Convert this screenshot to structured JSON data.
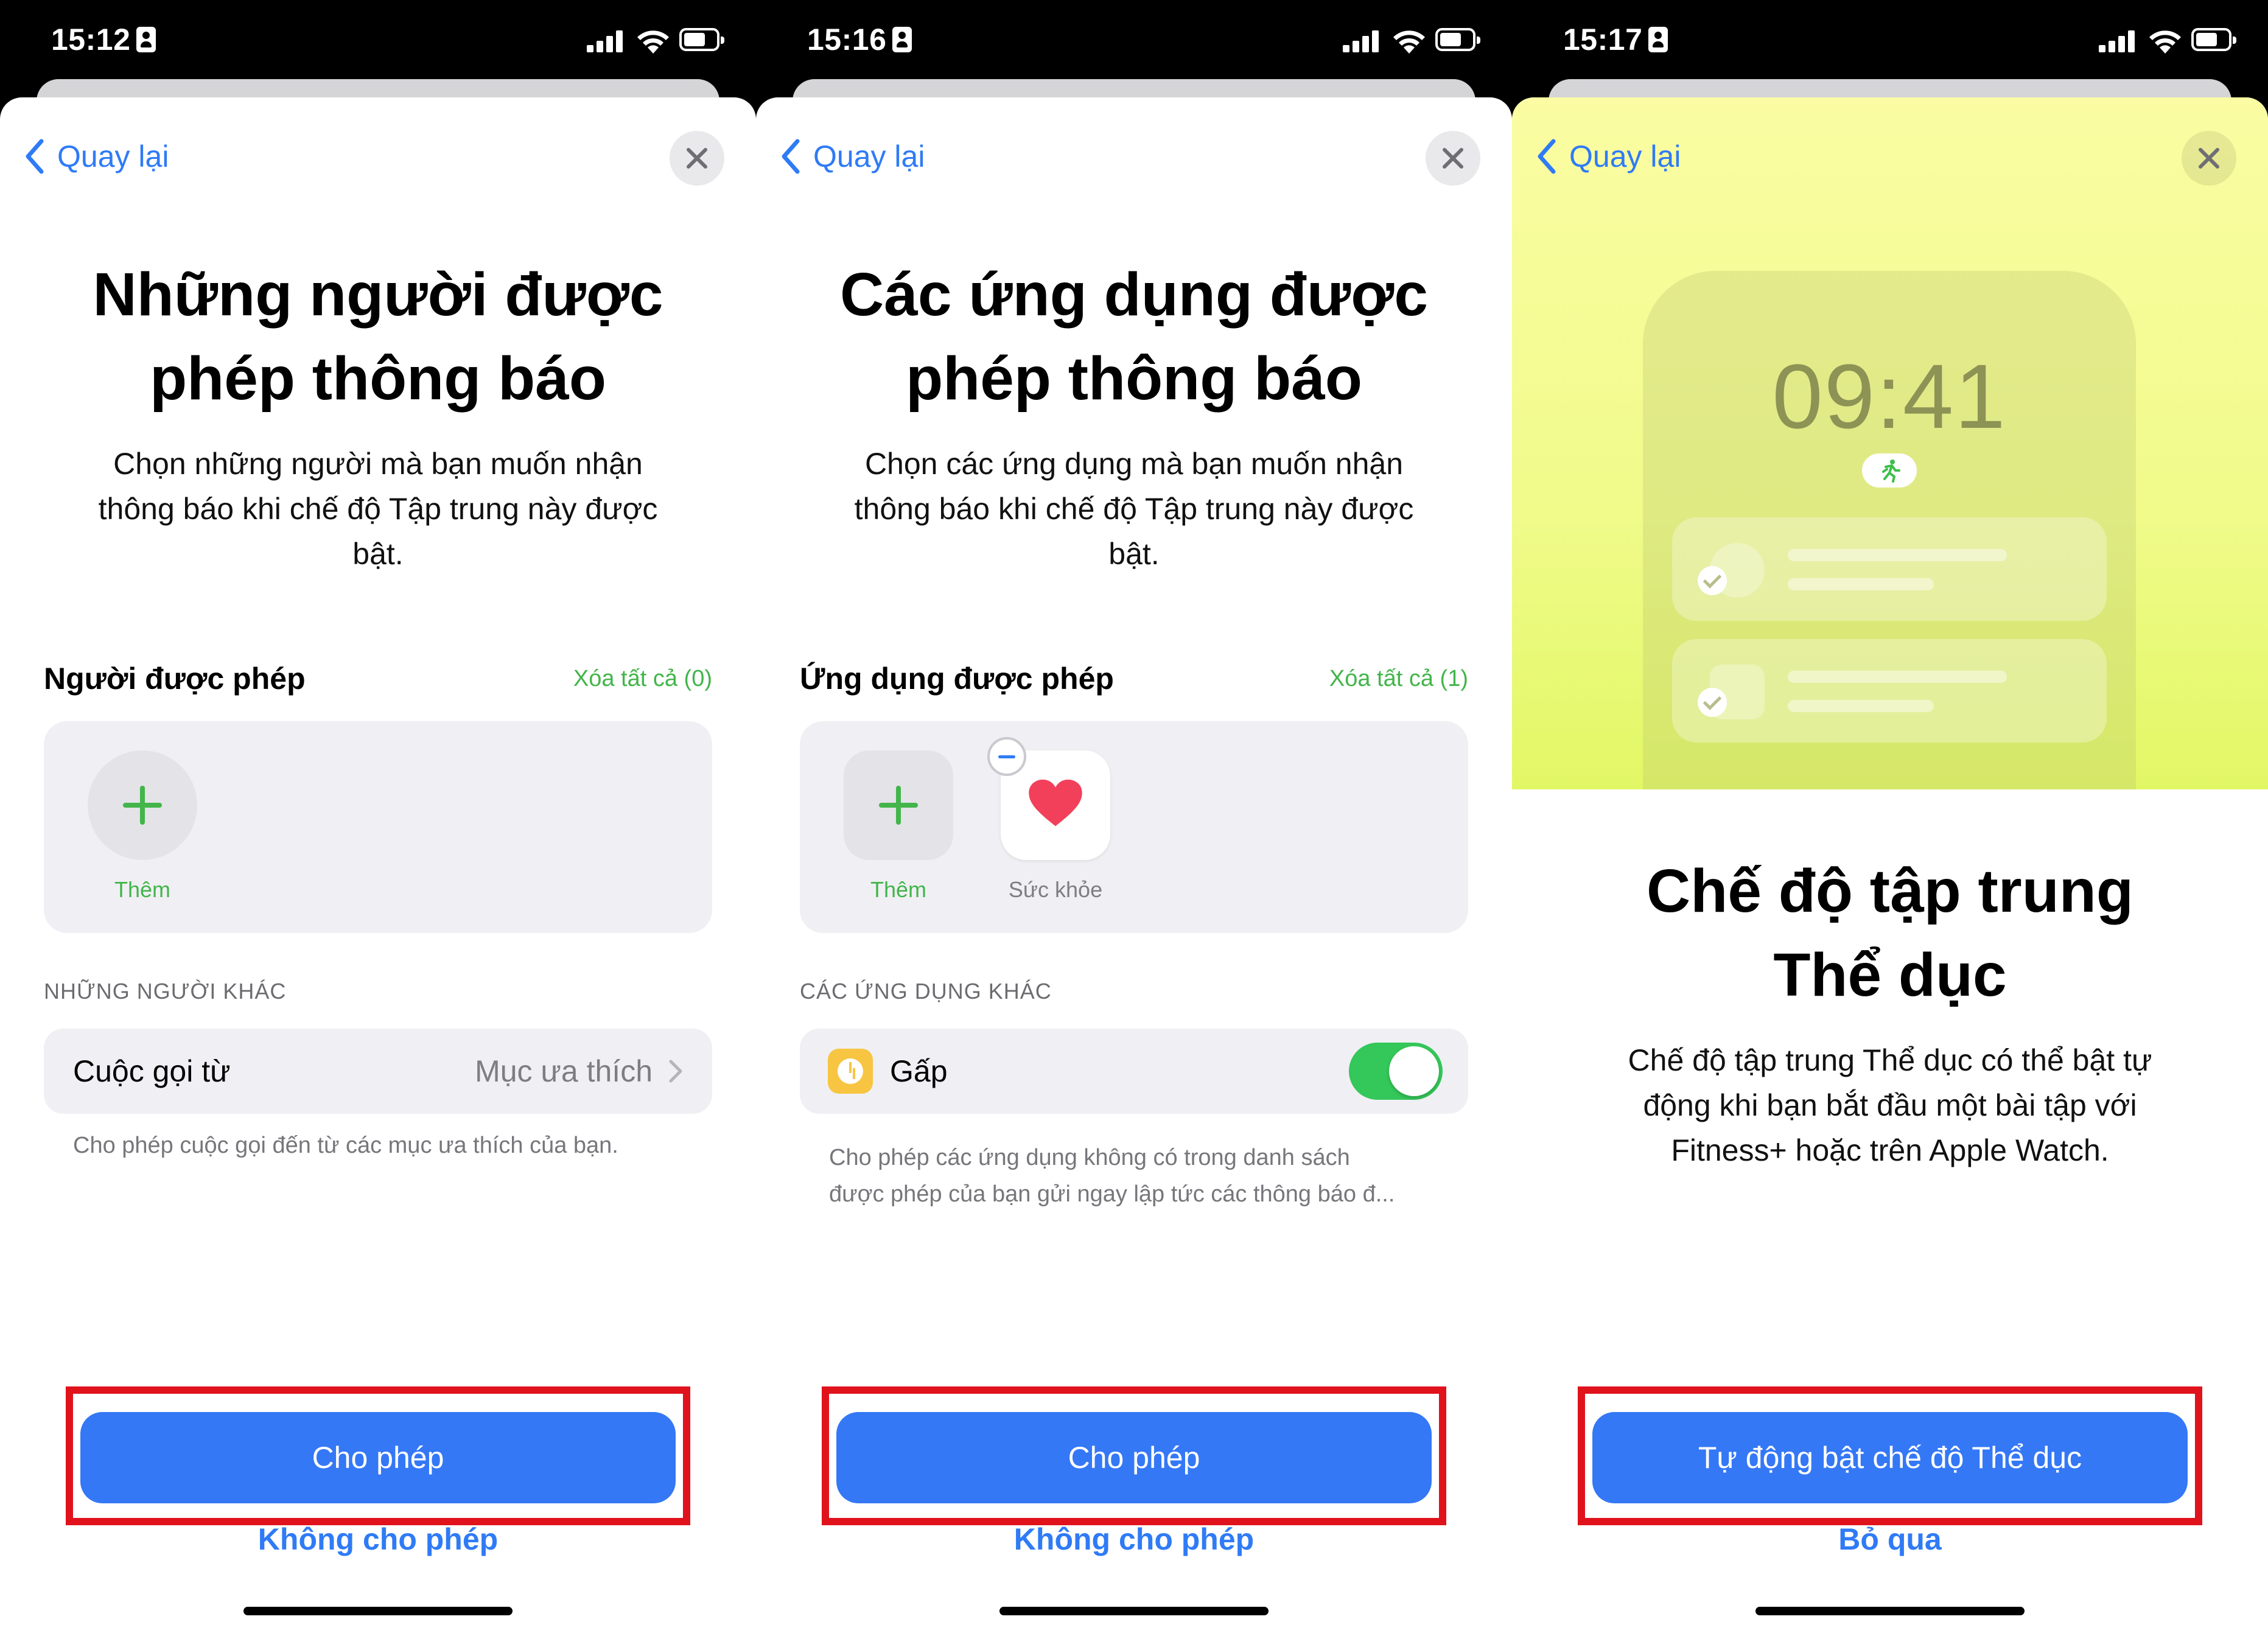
{
  "screens": [
    {
      "status": {
        "time": "15:12"
      },
      "nav": {
        "back_label": "Quay lại"
      },
      "title_line1": "Những người được",
      "title_line2": "phép thông báo",
      "description_lines": [
        "Chọn những người mà bạn muốn nhận",
        "thông báo khi chế độ Tập trung này được",
        "bật."
      ],
      "allowed_section": {
        "heading": "Người được phép",
        "clear_all": "Xóa tất cả (0)"
      },
      "add_tile_label": "Thêm",
      "other_section_caps": "NHỮNG NGƯỜI KHÁC",
      "calls_row": {
        "label": "Cuộc gọi từ",
        "value": "Mục ưa thích"
      },
      "calls_footnote": "Cho phép cuộc gọi đến từ các mục ưa thích của bạn.",
      "primary_button": "Cho phép",
      "secondary_button": "Không cho phép"
    },
    {
      "status": {
        "time": "15:16"
      },
      "nav": {
        "back_label": "Quay lại"
      },
      "title_line1": "Các ứng dụng được",
      "title_line2": "phép thông báo",
      "description_lines": [
        "Chọn các ứng dụng mà bạn muốn nhận",
        "thông báo khi chế độ Tập trung này được",
        "bật."
      ],
      "allowed_section": {
        "heading": "Ứng dụng được phép",
        "clear_all": "Xóa tất cả (1)"
      },
      "add_tile_label": "Thêm",
      "app_tile_label": "Sức khỏe",
      "other_section_caps": "CÁC ỨNG DỤNG KHÁC",
      "urgent_row": {
        "label": "Gấp",
        "toggle_on": true
      },
      "urgent_footnote_lines": [
        "Cho phép các ứng dụng không có trong danh sách",
        "được phép của bạn gửi ngay lập tức các thông báo đ..."
      ],
      "primary_button": "Cho phép",
      "secondary_button": "Không cho phép"
    },
    {
      "status": {
        "time": "15:17"
      },
      "nav": {
        "back_label": "Quay lại"
      },
      "preview_time": "09:41",
      "title_line1": "Chế độ tập trung",
      "title_line2": "Thể dục",
      "description_lines": [
        "Chế độ tập trung Thể dục có thể bật tự",
        "động khi bạn bắt đầu một bài tập với",
        "Fitness+ hoặc trên Apple Watch."
      ],
      "primary_button": "Tự động bật chế độ Thể dục",
      "secondary_button": "Bỏ qua"
    }
  ],
  "colors": {
    "accent": "#2f7bf6",
    "primary_button": "#3478f6",
    "green": "#43b54a",
    "highlight": "#e0121b",
    "toggle": "#34c759"
  }
}
